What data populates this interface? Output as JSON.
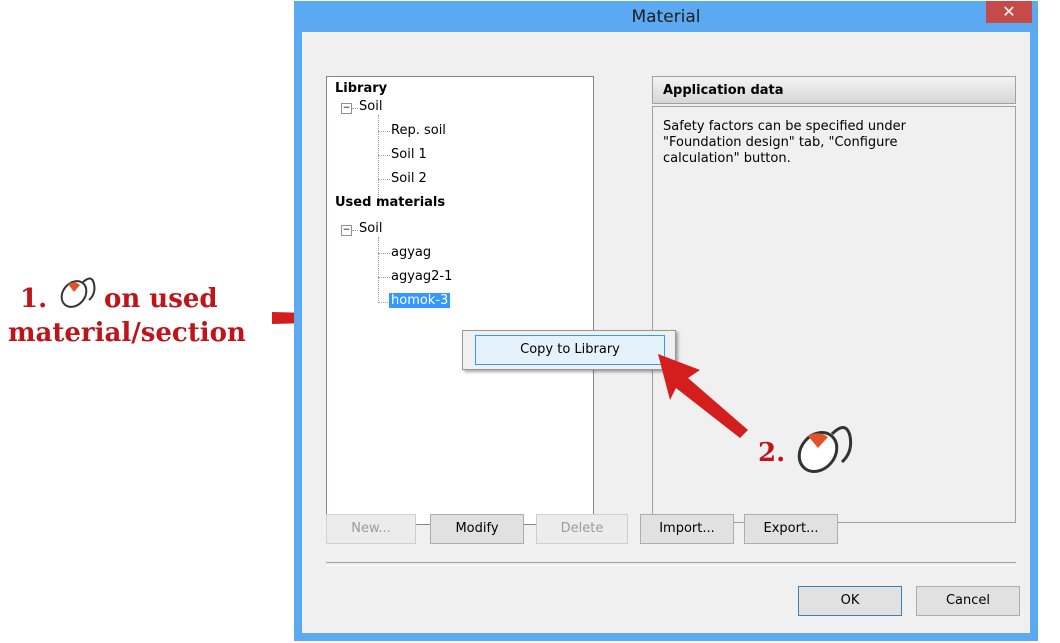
{
  "window": {
    "title": "Material",
    "close_glyph": "✕"
  },
  "tree": {
    "library_label": "Library",
    "library_group": "Soil",
    "library_items": [
      "Rep. soil",
      "Soil 1",
      "Soil 2"
    ],
    "used_label": "Used materials",
    "used_group": "Soil",
    "used_items": [
      "agyag",
      "agyag2-1",
      "homok-3"
    ],
    "selected_item": "homok-3"
  },
  "panel": {
    "title": "Application data",
    "text": "Safety factors can be specified under \"Foundation design\" tab, \"Configure calculation\" button."
  },
  "buttons": {
    "new": "New...",
    "modify": "Modify",
    "delete": "Delete",
    "import": "Import...",
    "export": "Export...",
    "ok": "OK",
    "cancel": "Cancel"
  },
  "context_menu": {
    "item": "Copy to Library"
  },
  "annotations": {
    "step1_num": "1.",
    "step1_tail": "on used",
    "step1_line2": "material/section",
    "step2_num": "2."
  },
  "colors": {
    "accent": "#5aa9f1",
    "annotation": "#c0141b",
    "selection": "#3399ff"
  }
}
